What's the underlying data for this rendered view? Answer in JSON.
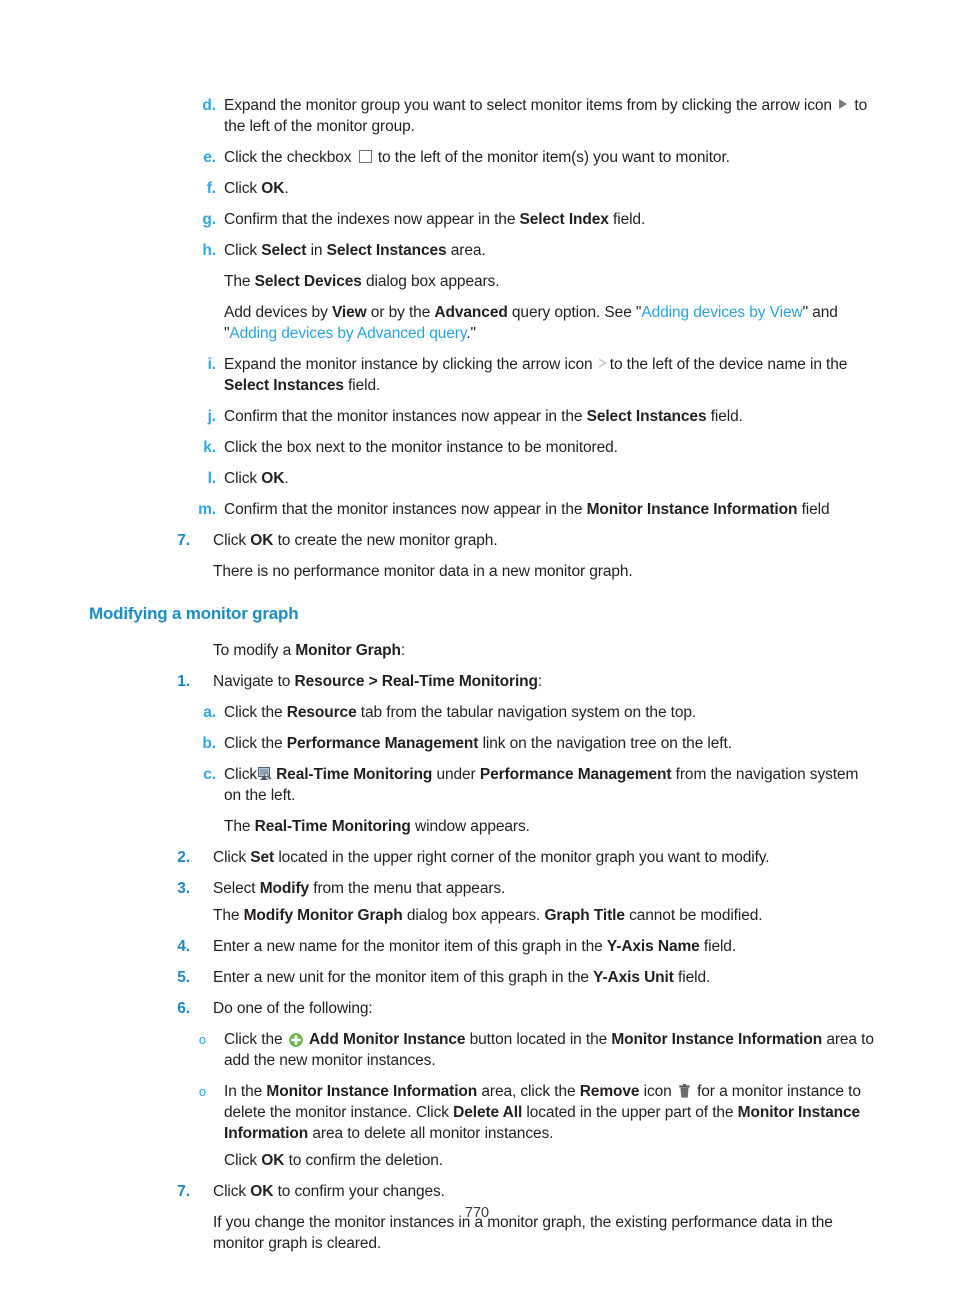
{
  "page": {
    "number": "770"
  },
  "steps_continued": {
    "items": [
      {
        "marker": "d.",
        "text_parts": [
          {
            "t": "Expand the monitor group you want to select monitor items from by clicking the arrow icon ",
            "style": "normal"
          },
          {
            "t": "ICON:arrow-filled",
            "style": "icon"
          },
          {
            "t": " to the left of the monitor group.",
            "style": "normal"
          }
        ]
      },
      {
        "marker": "e.",
        "text_parts": [
          {
            "t": "Click the checkbox ",
            "style": "normal"
          },
          {
            "t": "ICON:checkbox",
            "style": "icon"
          },
          {
            "t": " to the left of the monitor item(s) you want to monitor.",
            "style": "normal"
          }
        ]
      },
      {
        "marker": "f.",
        "text_parts": [
          {
            "t": "Click ",
            "style": "normal"
          },
          {
            "t": "OK",
            "style": "bold"
          },
          {
            "t": ".",
            "style": "normal"
          }
        ]
      },
      {
        "marker": "g.",
        "text_parts": [
          {
            "t": "Confirm that the indexes now appear in the ",
            "style": "normal"
          },
          {
            "t": "Select Index",
            "style": "bold"
          },
          {
            "t": " field.",
            "style": "normal"
          }
        ]
      },
      {
        "marker": "h.",
        "text_parts": [
          {
            "t": "Click ",
            "style": "normal"
          },
          {
            "t": "Select",
            "style": "bold"
          },
          {
            "t": " in ",
            "style": "normal"
          },
          {
            "t": "Select Instances",
            "style": "bold"
          },
          {
            "t": " area.",
            "style": "normal"
          }
        ]
      }
    ],
    "note_select_devices": [
      {
        "t": "The ",
        "style": "normal"
      },
      {
        "t": "Select Devices",
        "style": "bold"
      },
      {
        "t": " dialog box appears.",
        "style": "normal"
      }
    ],
    "note_add_devices": [
      {
        "t": "Add devices by ",
        "style": "normal"
      },
      {
        "t": "View",
        "style": "bold"
      },
      {
        "t": " or by the ",
        "style": "normal"
      },
      {
        "t": "Advanced",
        "style": "bold"
      },
      {
        "t": " query option. See \"",
        "style": "normal"
      },
      {
        "t": "Adding devices by View",
        "style": "link"
      },
      {
        "t": "\" and \"",
        "style": "normal"
      },
      {
        "t": "Adding devices by Advanced query",
        "style": "link"
      },
      {
        "t": ".\"",
        "style": "normal"
      }
    ],
    "items2": [
      {
        "marker": "i.",
        "text_parts": [
          {
            "t": "Expand the monitor instance by clicking the arrow icon ",
            "style": "normal"
          },
          {
            "t": "ICON:arrow-hollow",
            "style": "icon"
          },
          {
            "t": "to the left of the device name in the ",
            "style": "normal"
          },
          {
            "t": "Select Instances",
            "style": "bold"
          },
          {
            "t": " field.",
            "style": "normal"
          }
        ]
      },
      {
        "marker": "j.",
        "text_parts": [
          {
            "t": "Confirm that the monitor instances now appear in the ",
            "style": "normal"
          },
          {
            "t": "Select Instances",
            "style": "bold"
          },
          {
            "t": " field.",
            "style": "normal"
          }
        ]
      },
      {
        "marker": "k.",
        "text_parts": [
          {
            "t": "Click the box next to the monitor instance to be monitored.",
            "style": "normal"
          }
        ]
      },
      {
        "marker": "l.",
        "text_parts": [
          {
            "t": "Click ",
            "style": "normal"
          },
          {
            "t": "OK",
            "style": "bold"
          },
          {
            "t": ".",
            "style": "normal"
          }
        ]
      },
      {
        "marker": "m.",
        "text_parts": [
          {
            "t": "Confirm that the monitor instances now appear in the ",
            "style": "normal"
          },
          {
            "t": "Monitor Instance Information",
            "style": "bold"
          },
          {
            "t": " field",
            "style": "normal"
          }
        ]
      }
    ],
    "step7": {
      "marker": "7.",
      "text_parts": [
        {
          "t": "Click ",
          "style": "normal"
        },
        {
          "t": "OK",
          "style": "bold"
        },
        {
          "t": " to create the new monitor graph.",
          "style": "normal"
        }
      ]
    },
    "step7_note": [
      {
        "t": "There is no performance monitor data in a new monitor graph.",
        "style": "normal"
      }
    ]
  },
  "section": {
    "heading": "Modifying a monitor graph",
    "intro": [
      {
        "t": "To modify a ",
        "style": "normal"
      },
      {
        "t": "Monitor Graph",
        "style": "bold"
      },
      {
        "t": ":",
        "style": "normal"
      }
    ],
    "step1": {
      "marker": "1.",
      "text_parts": [
        {
          "t": "Navigate to ",
          "style": "normal"
        },
        {
          "t": "Resource > Real-Time Monitoring",
          "style": "bold"
        },
        {
          "t": ":",
          "style": "normal"
        }
      ]
    },
    "substeps": [
      {
        "marker": "a.",
        "text_parts": [
          {
            "t": "Click the ",
            "style": "normal"
          },
          {
            "t": "Resource",
            "style": "bold"
          },
          {
            "t": " tab from the tabular navigation system on the top.",
            "style": "normal"
          }
        ]
      },
      {
        "marker": "b.",
        "text_parts": [
          {
            "t": "Click the ",
            "style": "normal"
          },
          {
            "t": "Performance Management",
            "style": "bold"
          },
          {
            "t": " link on the navigation tree on the left.",
            "style": "normal"
          }
        ]
      },
      {
        "marker": "c.",
        "text_parts": [
          {
            "t": "Click",
            "style": "normal"
          },
          {
            "t": "ICON:monitor-wrench",
            "style": "icon"
          },
          {
            "t": "Real-Time Monitoring",
            "style": "bold"
          },
          {
            "t": " under ",
            "style": "normal"
          },
          {
            "t": "Performance Management",
            "style": "bold"
          },
          {
            "t": " from the navigation system on the left.",
            "style": "normal"
          }
        ]
      }
    ],
    "substep_note": [
      {
        "t": "The ",
        "style": "normal"
      },
      {
        "t": "Real-Time Monitoring",
        "style": "bold"
      },
      {
        "t": " window appears.",
        "style": "normal"
      }
    ],
    "step2": {
      "marker": "2.",
      "text_parts": [
        {
          "t": "Click ",
          "style": "normal"
        },
        {
          "t": "Set",
          "style": "bold"
        },
        {
          "t": " located in the upper right corner of the monitor graph you want to modify.",
          "style": "normal"
        }
      ]
    },
    "step3": {
      "marker": "3.",
      "text_parts": [
        {
          "t": "Select ",
          "style": "normal"
        },
        {
          "t": "Modify",
          "style": "bold"
        },
        {
          "t": " from the menu that appears.",
          "style": "normal"
        }
      ]
    },
    "step3_note": [
      {
        "t": "The ",
        "style": "normal"
      },
      {
        "t": "Modify Monitor Graph",
        "style": "bold"
      },
      {
        "t": " dialog box appears. ",
        "style": "normal"
      },
      {
        "t": "Graph Title",
        "style": "bold"
      },
      {
        "t": " cannot be modified.",
        "style": "normal"
      }
    ],
    "step4": {
      "marker": "4.",
      "text_parts": [
        {
          "t": "Enter a new name for the monitor item of this graph in the ",
          "style": "normal"
        },
        {
          "t": "Y-Axis Name",
          "style": "bold"
        },
        {
          "t": " field.",
          "style": "normal"
        }
      ]
    },
    "step5": {
      "marker": "5.",
      "text_parts": [
        {
          "t": "Enter a new unit for the monitor item of this graph in the ",
          "style": "normal"
        },
        {
          "t": "Y-Axis Unit",
          "style": "bold"
        },
        {
          "t": " field.",
          "style": "normal"
        }
      ]
    },
    "step6": {
      "marker": "6.",
      "text_parts": [
        {
          "t": "Do one of the following:",
          "style": "normal"
        }
      ]
    },
    "bullets": [
      {
        "marker": "o",
        "text_parts": [
          {
            "t": "Click the ",
            "style": "normal"
          },
          {
            "t": "ICON:add-green",
            "style": "icon"
          },
          {
            "t": " ",
            "style": "normal"
          },
          {
            "t": "Add Monitor Instance",
            "style": "bold"
          },
          {
            "t": " button located in the ",
            "style": "normal"
          },
          {
            "t": "Monitor Instance Information",
            "style": "bold"
          },
          {
            "t": " area to add the new monitor instances.",
            "style": "normal"
          }
        ]
      },
      {
        "marker": "o",
        "text_parts": [
          {
            "t": "In the ",
            "style": "normal"
          },
          {
            "t": "Monitor Instance Information",
            "style": "bold"
          },
          {
            "t": " area, click the ",
            "style": "normal"
          },
          {
            "t": "Remove",
            "style": "bold"
          },
          {
            "t": " icon ",
            "style": "normal"
          },
          {
            "t": "ICON:trash",
            "style": "icon"
          },
          {
            "t": " for a monitor instance to delete the monitor instance. Click ",
            "style": "normal"
          },
          {
            "t": "Delete All",
            "style": "bold"
          },
          {
            "t": " located in the upper part of the ",
            "style": "normal"
          },
          {
            "t": "Monitor Instance Information",
            "style": "bold"
          },
          {
            "t": " area to delete all monitor instances.",
            "style": "normal"
          }
        ]
      }
    ],
    "bullet_note": [
      {
        "t": "Click ",
        "style": "normal"
      },
      {
        "t": "OK",
        "style": "bold"
      },
      {
        "t": " to confirm the deletion.",
        "style": "normal"
      }
    ],
    "step7": {
      "marker": "7.",
      "text_parts": [
        {
          "t": "Click ",
          "style": "normal"
        },
        {
          "t": "OK",
          "style": "bold"
        },
        {
          "t": " to confirm your changes.",
          "style": "normal"
        }
      ]
    },
    "step7_note": [
      {
        "t": "If you change the monitor instances in a monitor graph, the existing performance data in the monitor graph is cleared.",
        "style": "normal"
      }
    ]
  },
  "colors": {
    "heading_blue": "#1b8cc4",
    "number_blue": "#1a89c9",
    "letter_blue": "#2aa8de",
    "link_blue": "#29a3dc",
    "body_black": "#231f20",
    "add_icon_green": "#6cbe45",
    "trash_icon_gray": "#58595b"
  }
}
